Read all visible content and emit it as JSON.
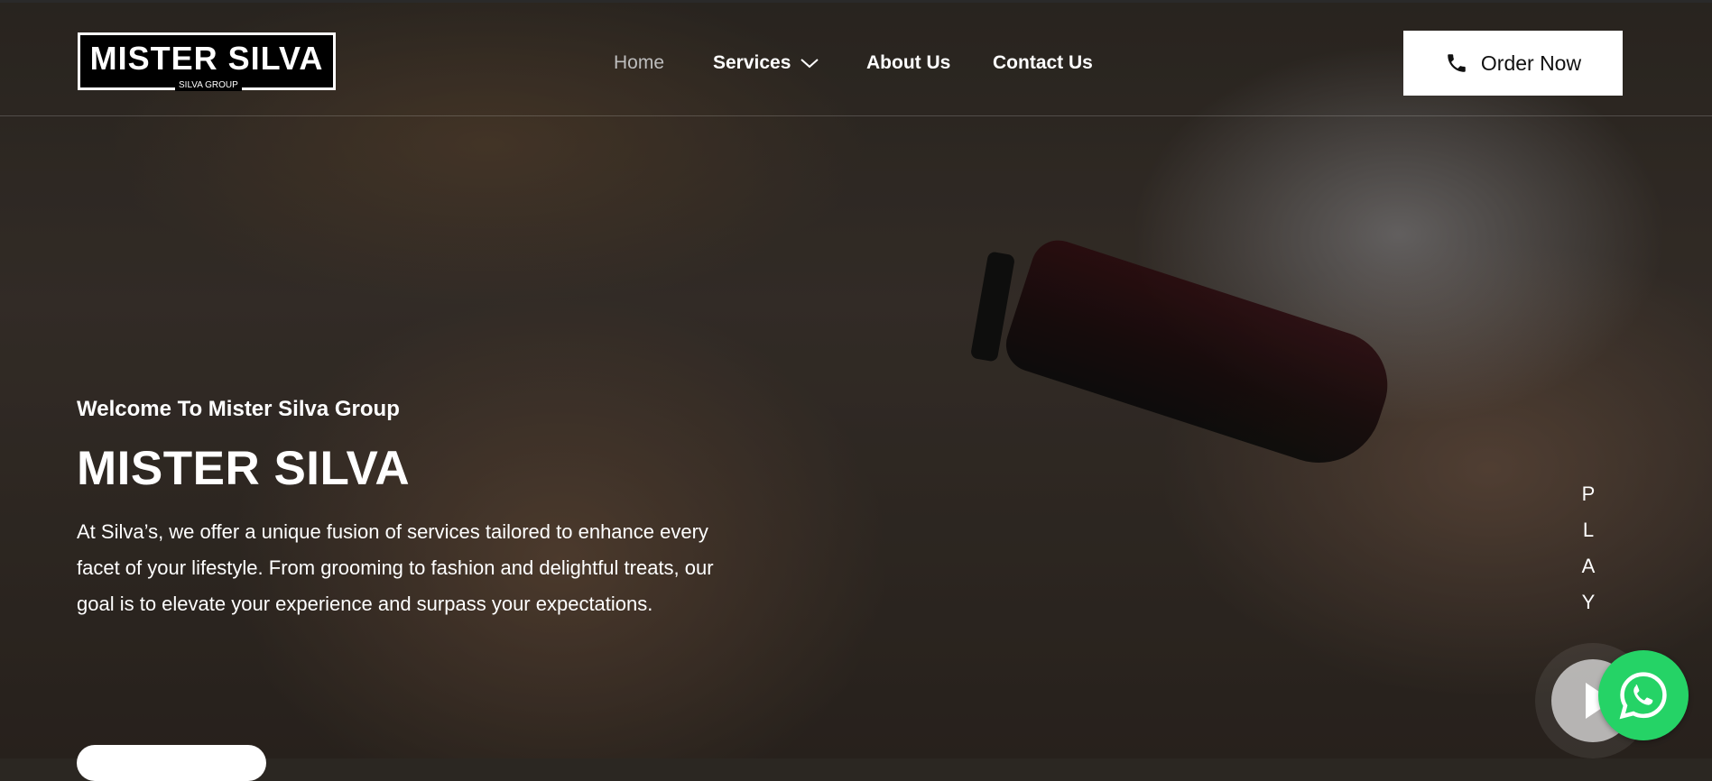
{
  "brand": {
    "logo_text": "MISTER SILVA",
    "logo_subtext": "SILVA GROUP"
  },
  "nav": {
    "items": [
      {
        "label": "Home",
        "active": true
      },
      {
        "label": "Services",
        "has_dropdown": true
      },
      {
        "label": "About Us"
      },
      {
        "label": "Contact Us"
      }
    ]
  },
  "header": {
    "order_button": {
      "label": "Order Now",
      "icon": "phone-icon"
    }
  },
  "hero": {
    "welcome": "Welcome To Mister Silva Group",
    "title": "MISTER SILVA",
    "description": "At Silva’s, we offer a unique fusion of services tailored to enhance every facet of your lifestyle. From grooming to fashion and delightful treats, our goal is to elevate your experience and surpass your expectations.",
    "play_letters": [
      "P",
      "L",
      "A",
      "Y"
    ]
  },
  "floating": {
    "whatsapp_icon": "whatsapp-icon",
    "play_icon": "play-icon"
  },
  "colors": {
    "whatsapp": "#25d366",
    "button_bg": "#ffffff",
    "nav_active": "#bdbdbd"
  }
}
